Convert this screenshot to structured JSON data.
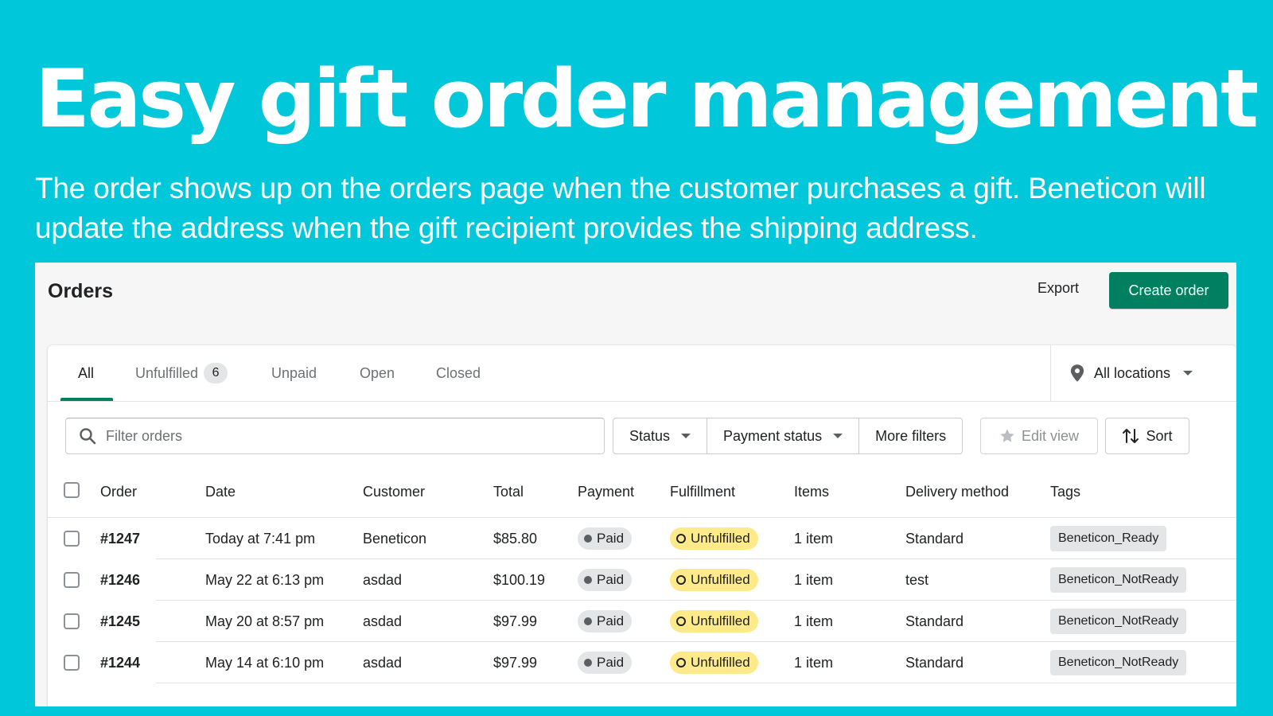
{
  "hero": {
    "title": "Easy gift order management",
    "subtitle": "The order shows up on the orders page when the customer purchases a gift. Beneticon will update the address when the gift recipient provides the shipping address."
  },
  "colors": {
    "background": "#00c8da",
    "primary": "#008060",
    "unfulfilled": "#ffea8a",
    "paid": "#e4e5e7"
  },
  "header": {
    "title": "Orders",
    "export_label": "Export",
    "create_label": "Create order"
  },
  "tabs": [
    {
      "label": "All",
      "active": true
    },
    {
      "label": "Unfulfilled",
      "count": "6"
    },
    {
      "label": "Unpaid"
    },
    {
      "label": "Open"
    },
    {
      "label": "Closed"
    }
  ],
  "locations": {
    "label": "All locations",
    "icon": "location-pin-icon"
  },
  "filters": {
    "search_placeholder": "Filter orders",
    "status": "Status",
    "payment_status": "Payment status",
    "more_filters": "More filters",
    "edit_view": "Edit view",
    "sort": "Sort"
  },
  "table": {
    "columns": [
      "Order",
      "Date",
      "Customer",
      "Total",
      "Payment",
      "Fulfillment",
      "Items",
      "Delivery method",
      "Tags"
    ],
    "rows": [
      {
        "order": "#1247",
        "date": "Today at 7:41 pm",
        "customer": "Beneticon",
        "total": "$85.80",
        "payment": "Paid",
        "fulfillment": "Unfulfilled",
        "items": "1 item",
        "delivery": "Standard",
        "tag": "Beneticon_Ready"
      },
      {
        "order": "#1246",
        "date": "May 22 at 6:13 pm",
        "customer": "asdad",
        "total": "$100.19",
        "payment": "Paid",
        "fulfillment": "Unfulfilled",
        "items": "1 item",
        "delivery": "test",
        "tag": "Beneticon_NotReady"
      },
      {
        "order": "#1245",
        "date": "May 20 at 8:57 pm",
        "customer": "asdad",
        "total": "$97.99",
        "payment": "Paid",
        "fulfillment": "Unfulfilled",
        "items": "1 item",
        "delivery": "Standard",
        "tag": "Beneticon_NotReady"
      },
      {
        "order": "#1244",
        "date": "May 14 at 6:10 pm",
        "customer": "asdad",
        "total": "$97.99",
        "payment": "Paid",
        "fulfillment": "Unfulfilled",
        "items": "1 item",
        "delivery": "Standard",
        "tag": "Beneticon_NotReady"
      }
    ]
  }
}
